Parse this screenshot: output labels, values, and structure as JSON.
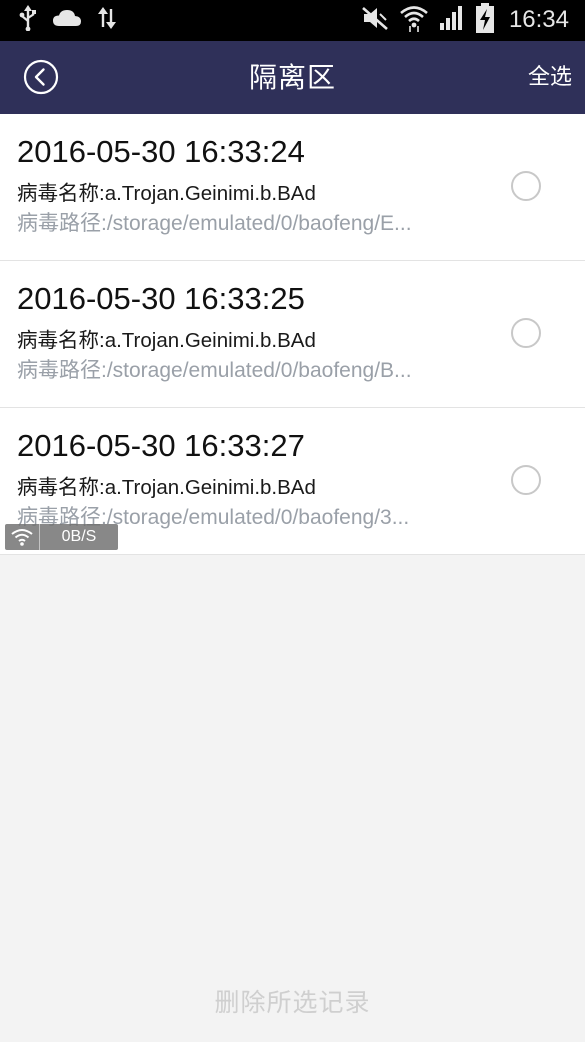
{
  "status_bar": {
    "time": "16:34",
    "left_icons": [
      "usb-icon",
      "cloud-icon",
      "data-transfer-icon"
    ],
    "right_icons": [
      "mute-icon",
      "wifi-icon",
      "signal-icon",
      "battery-charging-icon"
    ]
  },
  "header": {
    "back_icon": "back-circle-icon",
    "title": "隔离区",
    "select_all_label": "全选",
    "background_color": "#2f3059"
  },
  "list": {
    "items": [
      {
        "time": "2016-05-30 16:33:24",
        "name": "病毒名称:a.Trojan.Geinimi.b.BAd",
        "path": "病毒路径:/storage/emulated/0/baofeng/E...",
        "selected": false
      },
      {
        "time": "2016-05-30 16:33:25",
        "name": "病毒名称:a.Trojan.Geinimi.b.BAd",
        "path": "病毒路径:/storage/emulated/0/baofeng/B...",
        "selected": false
      },
      {
        "time": "2016-05-30 16:33:27",
        "name": "病毒名称:a.Trojan.Geinimi.b.BAd",
        "path": "病毒路径:/storage/emulated/0/baofeng/3...",
        "selected": false
      }
    ]
  },
  "net_badge": {
    "speed": "0B/S"
  },
  "bottom": {
    "delete_label": "删除所选记录"
  }
}
